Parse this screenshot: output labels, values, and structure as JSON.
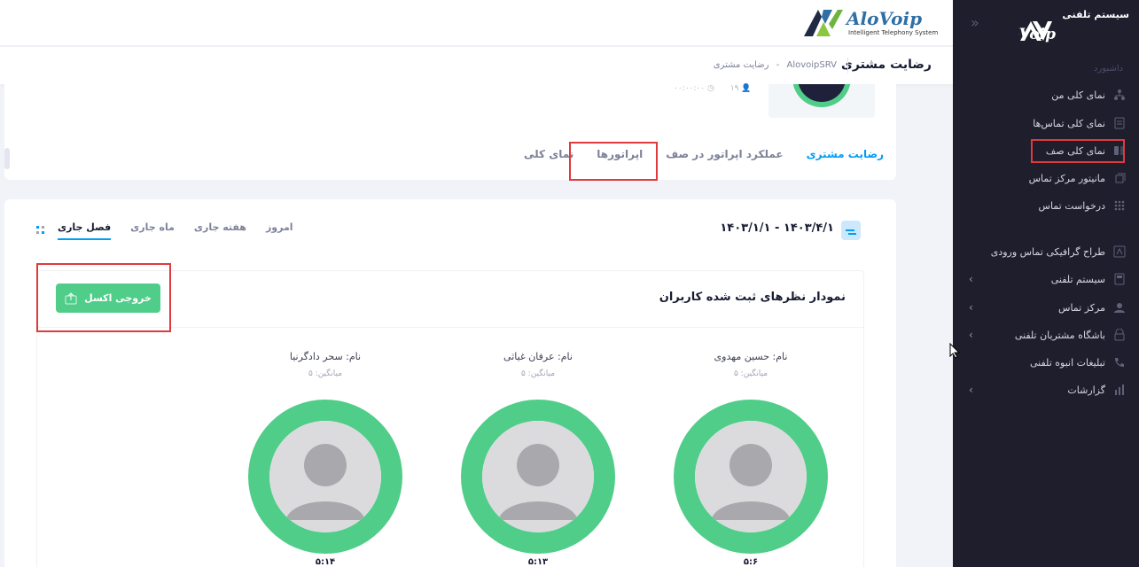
{
  "brand": {
    "name": "AloVoip",
    "tagline": "Intelligent Telephony System",
    "sidebar_tag": "سیستم تلفنی",
    "sidebar_name": "AloVoip"
  },
  "header": {
    "page_title": "رضایت مشتری",
    "breadcrumb": [
      "AlovoipSRV",
      "-",
      "رضایت مشتری"
    ]
  },
  "sidebar": {
    "section": "داشبورد",
    "items": [
      {
        "label": "نمای کلی من",
        "icon": "hierarchy-icon"
      },
      {
        "label": "نمای کلی تماس‌ها",
        "icon": "phonebook-icon"
      },
      {
        "label": "نمای کلی صف",
        "icon": "queue-icon"
      },
      {
        "label": "مانیتور مرکز تماس",
        "icon": "monitor-icon"
      },
      {
        "label": "درخواست تماس",
        "icon": "dots-grid-icon"
      },
      {
        "label": "طراح گرافیکی تماس ورودی",
        "icon": "designer-icon"
      },
      {
        "label": "سیستم تلفنی",
        "icon": "phone-system-icon"
      },
      {
        "label": "مرکز تماس",
        "icon": "agent-icon"
      },
      {
        "label": "باشگاه مشتریان تلفنی",
        "icon": "club-icon"
      },
      {
        "label": "تبلیغات انبوه تلفنی",
        "icon": "phone-icon"
      },
      {
        "label": "گزارشات",
        "icon": "chart-icon"
      }
    ]
  },
  "profile": {
    "count": "۱۹",
    "duration": "۰۰:۰۰:۰۰"
  },
  "tabs": [
    "نمای کلی",
    "اپراتورها",
    "عملکرد اپراتور در صف",
    "رضایت مشتری"
  ],
  "period": {
    "date_range": "۱۴۰۳/۴/۱ - ۱۴۰۳/۱/۱",
    "options": [
      "امروز",
      "هفته جاری",
      "ماه جاری",
      "فصل جاری"
    ]
  },
  "panel": {
    "title": "نمودار نظرهای ثبت شده کاربران",
    "export_label": "خروجی اکسل"
  },
  "users": [
    {
      "name": "نام: حسین مهدوی",
      "average": "میانگین: ۵",
      "score": "۵:۶"
    },
    {
      "name": "نام: عرفان غیاثی",
      "average": "میانگین: ۵",
      "score": "۵:۱۳"
    },
    {
      "name": "نام: سحر دادگرنیا",
      "average": "میانگین: ۵",
      "score": "۵:۱۴"
    }
  ],
  "colors": {
    "accent": "#009ef7",
    "success": "#50cd89",
    "sidebar_bg": "#1e1e2d",
    "highlight": "#e0393e"
  }
}
